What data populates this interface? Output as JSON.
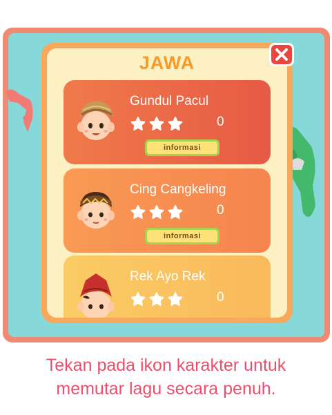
{
  "panel": {
    "title": "JAWA",
    "close_icon": "close-x-icon"
  },
  "songs": [
    {
      "title": "Gundul Pacul",
      "score": "0",
      "info_label": "informasi",
      "stars": 3,
      "character": "boy-blangkon-icon"
    },
    {
      "title": "Cing Cangkeling",
      "score": "0",
      "info_label": "informasi",
      "stars": 3,
      "character": "boy-headband-icon"
    },
    {
      "title": "Rek Ayo Rek",
      "score": "0",
      "stars": 3,
      "character": "boy-red-cap-icon"
    }
  ],
  "caption": {
    "line1": "Tekan pada ikon karakter untuk",
    "line2": "memutar lagu secara penuh."
  },
  "colors": {
    "frame": "#f08a72",
    "sea": "#86d9d8",
    "panel_border": "#f7a85a",
    "title": "#f59b2a",
    "caption": "#ec4f6e"
  }
}
